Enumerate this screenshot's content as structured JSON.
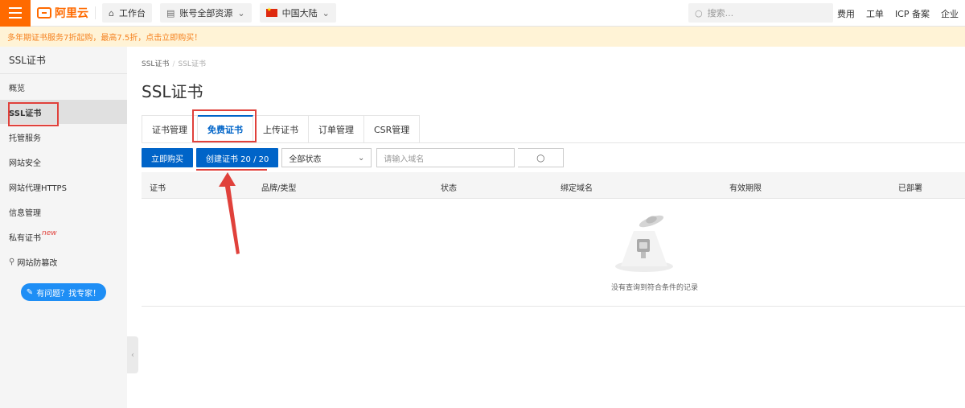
{
  "topbar": {
    "logo_text": "阿里云",
    "workbench": "工作台",
    "account_resources": "账号全部资源",
    "region": "中国大陆",
    "search_placeholder": "搜索...",
    "nav": [
      "费用",
      "工单",
      "ICP 备案",
      "企业"
    ]
  },
  "notice": "多年期证书服务7折起购，最高7.5折，点击立即购买！",
  "sidebar": {
    "title": "SSL证书",
    "items": [
      "概览",
      "SSL证书",
      "托管服务",
      "网站安全",
      "网站代理HTTPS",
      "信息管理",
      "私有证书",
      "网站防篡改"
    ],
    "new_badge": "new",
    "expert_button": "有问题？找专家！"
  },
  "breadcrumb": [
    "SSL证书",
    "SSL证书"
  ],
  "page_title": "SSL证书",
  "tabs": [
    "证书管理",
    "免费证书",
    "上传证书",
    "订单管理",
    "CSR管理"
  ],
  "toolbar": {
    "buy_button": "立即购买",
    "create_button": "创建证书 20 / 20",
    "status_select": "全部状态",
    "domain_placeholder": "请输入域名"
  },
  "table": {
    "columns": [
      "证书",
      "品牌/类型",
      "状态",
      "绑定域名",
      "有效期限",
      "已部署"
    ],
    "empty_text": "没有查询到符合条件的记录"
  },
  "colors": {
    "brand_orange": "#ff6a00",
    "primary_blue": "#0064c8",
    "highlight_red": "#e0413b"
  }
}
